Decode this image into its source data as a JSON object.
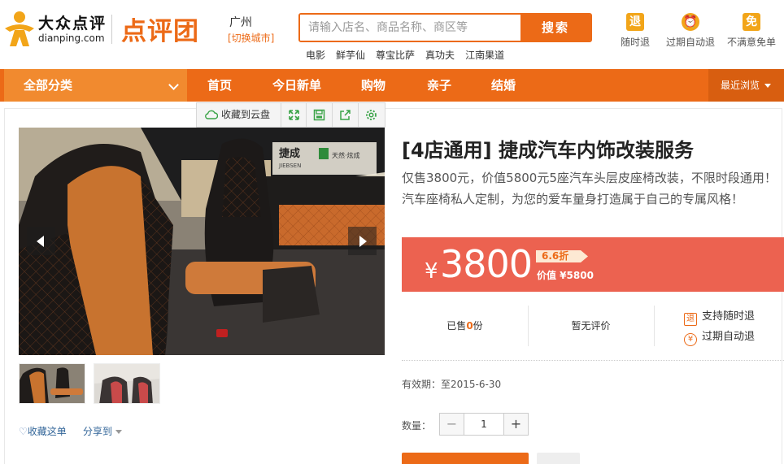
{
  "header": {
    "brand_cn": "大众点评",
    "brand_en": "dianping.com",
    "tuan_logo": "点评团",
    "city": "广州",
    "switch_city": "[切换城市]",
    "search": {
      "placeholder": "请输入店名、商品名称、商区等",
      "button_label": "搜索"
    },
    "hot_words": [
      "电影",
      "鲜芋仙",
      "尊宝比萨",
      "真功夫",
      "江南果道"
    ],
    "promises": [
      {
        "label": "随时退",
        "icon_text": "退",
        "icon": "refund-anytime-icon"
      },
      {
        "label": "过期自动退",
        "icon_text": "⏰",
        "icon": "alarm-clock-icon"
      },
      {
        "label": "不满意免单",
        "icon_text": "免",
        "icon": "free-order-icon"
      }
    ]
  },
  "nav": {
    "all_categories": "全部分类",
    "items": [
      "首页",
      "今日新单",
      "购物",
      "亲子",
      "结婚"
    ],
    "recent": "最近浏览"
  },
  "toolbar": {
    "save_to_cloud": "收藏到云盘",
    "icons": [
      "fullscreen-icon",
      "save-icon",
      "export-icon",
      "settings-icon"
    ]
  },
  "gallery": {
    "favorite": "收藏这单",
    "share": "分享到"
  },
  "deal": {
    "title": "[4店通用] 捷成汽车内饰改装服务",
    "description": "仅售3800元，价值5800元5座汽车头层皮座椅改装，不限时段通用！汽车座椅私人定制，为您的爱车量身打造属于自己的专属风格！",
    "currency": "¥",
    "price": "3800",
    "discount": "6.6折",
    "original_price": "价值 ¥5800",
    "sold_prefix": "已售",
    "sold_count": "0",
    "sold_suffix": "份",
    "rating": "暂无评价",
    "guarantees": [
      {
        "icon_text": "退",
        "label": "支持随时退"
      },
      {
        "icon_text": "¥",
        "label": "过期自动退"
      }
    ],
    "validity": "有效期：至2015-6-30",
    "quantity_label": "数量：",
    "quantity": "1",
    "minus": "−",
    "plus": "+"
  },
  "photo": {
    "brand_text": "捷成",
    "brand_en": "JIEBSEN",
    "sub_text": "天然·炫成"
  },
  "colors": {
    "accent": "#ec6a17",
    "price_bg": "#ec6250",
    "nav_bg": "#ec6a17"
  }
}
